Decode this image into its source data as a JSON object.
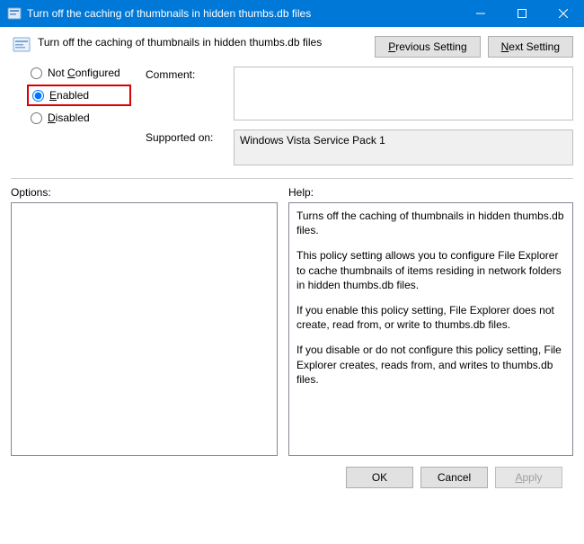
{
  "titlebar": {
    "title": "Turn off the caching of thumbnails in hidden thumbs.db files"
  },
  "header": {
    "title": "Turn off the caching of thumbnails in hidden thumbs.db files",
    "previous_btn_pre": "",
    "previous_btn_u": "P",
    "previous_btn_post": "revious Setting",
    "next_btn_pre": "",
    "next_btn_u": "N",
    "next_btn_post": "ext Setting"
  },
  "radios": {
    "not_configured_pre": "Not ",
    "not_configured_u": "C",
    "not_configured_post": "onfigured",
    "enabled_u": "E",
    "enabled_post": "nabled",
    "disabled_u": "D",
    "disabled_post": "isabled",
    "selected": "enabled"
  },
  "fields": {
    "comment_label": "Comment:",
    "comment_value": "",
    "supported_label": "Supported on:",
    "supported_value": "Windows Vista Service Pack 1"
  },
  "panels": {
    "options_label": "Options:",
    "help_label": "Help:",
    "help_p1": "Turns off the caching of thumbnails in hidden thumbs.db files.",
    "help_p2": "This policy setting allows you to configure File Explorer to cache thumbnails of items residing in network folders in hidden thumbs.db files.",
    "help_p3": "If you enable this policy setting, File Explorer does not create, read from, or write to thumbs.db files.",
    "help_p4": "If you disable or do not configure this policy setting, File Explorer creates, reads from, and writes to thumbs.db files."
  },
  "footer": {
    "ok": "OK",
    "cancel": "Cancel",
    "apply_u": "A",
    "apply_post": "pply"
  }
}
